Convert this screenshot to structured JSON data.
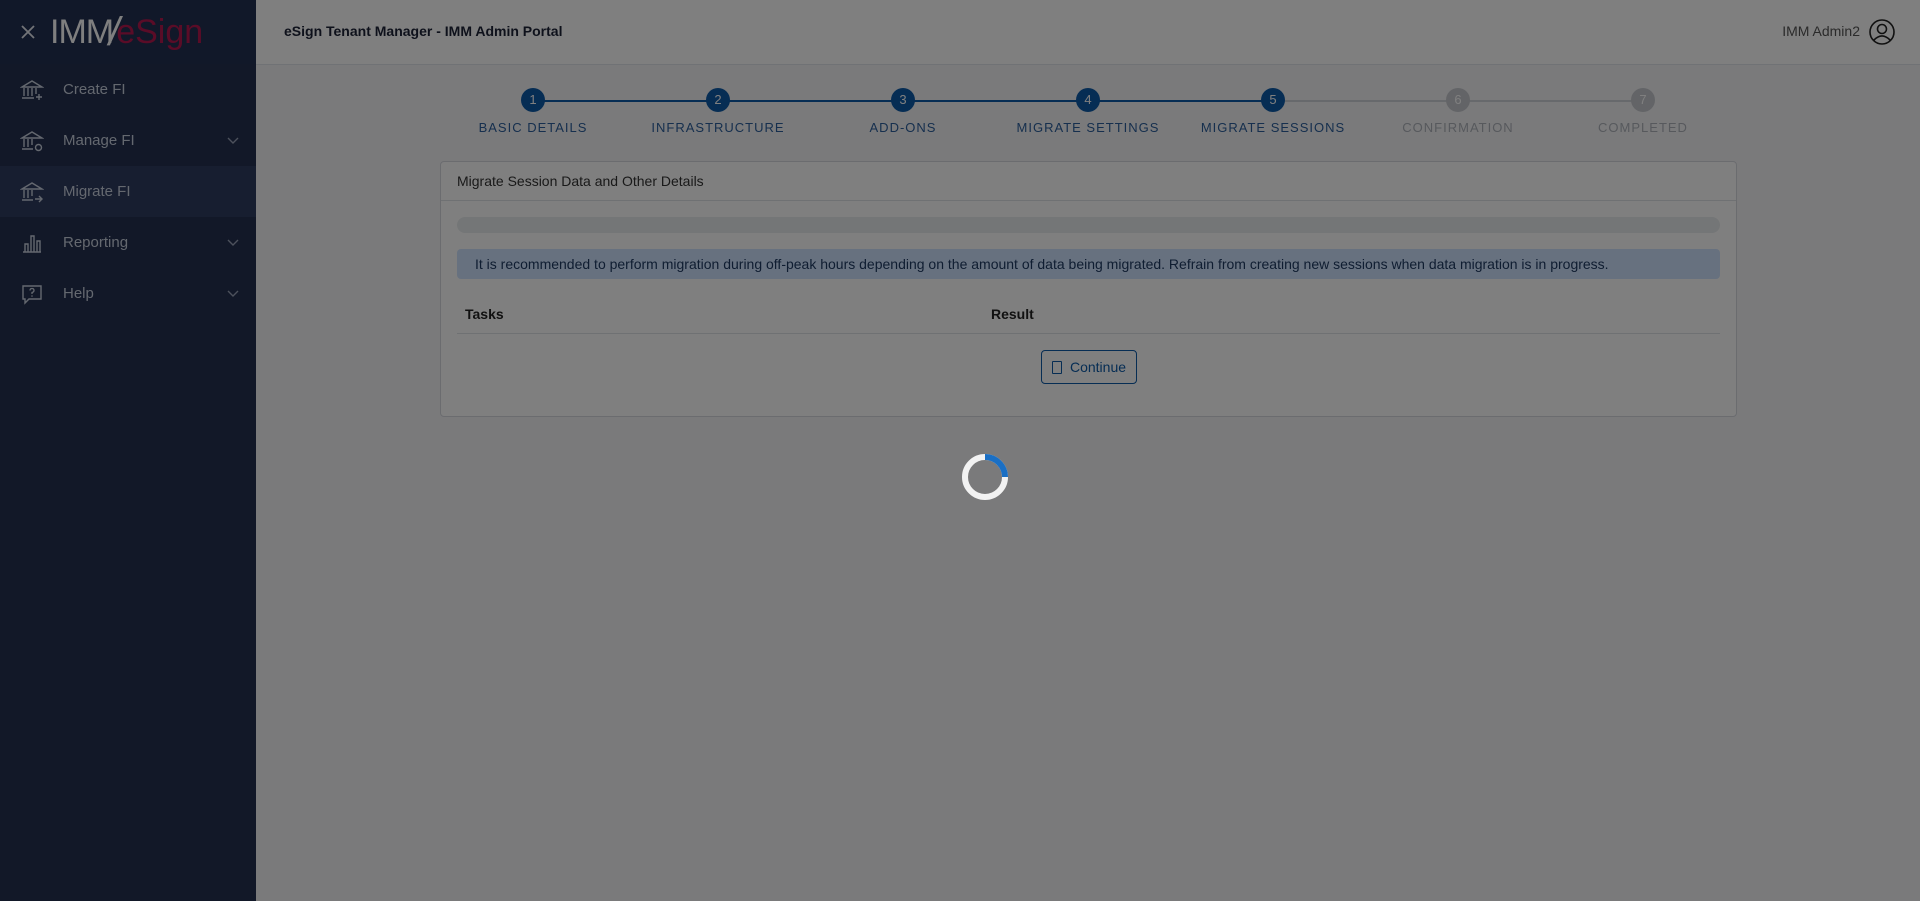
{
  "sidebar": {
    "logo": {
      "part1": "IMM",
      "slash": "/",
      "part2": "eSign"
    },
    "items": [
      {
        "label": "Create FI",
        "icon": "bank-add-icon"
      },
      {
        "label": "Manage FI",
        "icon": "bank-settings-icon"
      },
      {
        "label": "Migrate FI",
        "icon": "bank-migrate-icon"
      },
      {
        "label": "Reporting",
        "icon": "bar-chart-icon"
      },
      {
        "label": "Help",
        "icon": "help-chat-icon"
      }
    ]
  },
  "header": {
    "title": "eSign Tenant Manager - IMM Admin Portal",
    "user": "IMM Admin2"
  },
  "stepper": {
    "steps": [
      {
        "num": "1",
        "label": "BASIC DETAILS"
      },
      {
        "num": "2",
        "label": "INFRASTRUCTURE"
      },
      {
        "num": "3",
        "label": "ADD-ONS"
      },
      {
        "num": "4",
        "label": "MIGRATE SETTINGS"
      },
      {
        "num": "5",
        "label": "MIGRATE SESSIONS"
      },
      {
        "num": "6",
        "label": "CONFIRMATION"
      },
      {
        "num": "7",
        "label": "COMPLETED"
      }
    ],
    "current_step": 5
  },
  "card": {
    "title": "Migrate Session Data and Other Details",
    "progress_fraction": 0,
    "alert": "It is recommended to perform migration during off-peak hours depending on the amount of data being migrated. Refrain from creating new sessions when data migration is in progress.",
    "columns": [
      "Tasks",
      "Result"
    ],
    "continue_label": "Continue"
  },
  "colors": {
    "sidebar_bg": "#243151",
    "accent": "#0c5aa8",
    "brand": "#b5184f",
    "overlay": "rgba(0,0,0,0.5)"
  }
}
